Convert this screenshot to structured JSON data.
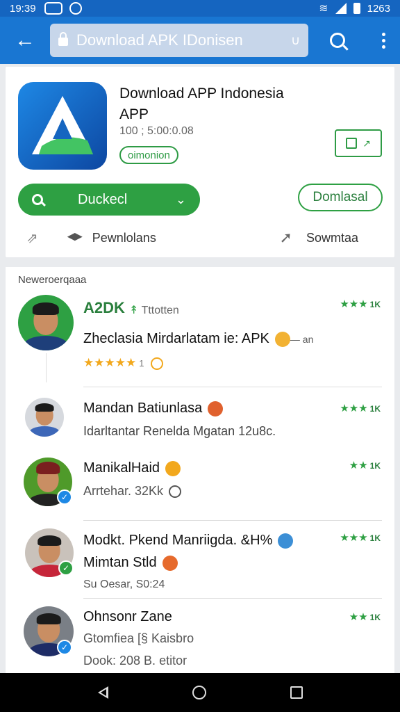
{
  "status_bar": {
    "time": "19:39",
    "battery": "1263"
  },
  "toolbar": {
    "search_text": "Download APK IDonisen"
  },
  "app": {
    "title": "Download APP Indonesia APP",
    "meta": "100 ; 5:00:0.08",
    "badge": "oimonion",
    "install_label": "Duckecl",
    "download_label": "Domlasal",
    "stat_left": "Pewnlolans",
    "stat_right": "Sowmtaa",
    "icon_colors": {
      "bg": "#1976d2",
      "accent": "#43c463"
    }
  },
  "reviews": {
    "heading": "Neweroerqaaa",
    "items": [
      {
        "name": "A2DK",
        "tag": "Tttotten",
        "sub": "Zheclasia Mirdarlatam ie: APK",
        "sub_suffix": "— an",
        "stars_text": "★★★★★",
        "stars_count": "1",
        "rating_stars": "★★★",
        "rating_count": "1K",
        "avatar_bg": "#2ea043",
        "shirt": "#1e3f7a"
      },
      {
        "name": "Mandan Batiunlasa",
        "sub": "Idarltantar Renelda Mgatan 12u8c.",
        "rating_stars": "★★★",
        "rating_count": "1K",
        "avatar_bg": "#d6d9de",
        "shirt": "#3d67b8"
      },
      {
        "name": "ManikalHaid",
        "sub": "Arrtehar. 32Kk",
        "rating_stars": "★★",
        "rating_count": "1K",
        "avatar_bg": "#4f9a2a",
        "shirt": "#222"
      },
      {
        "name": "Modkt. Pkend Manriigda.",
        "name_suffix": "&H%",
        "sub": "Mimtan Stld",
        "sub2": "Su Oesar, S0:24",
        "rating_stars": "★★★",
        "rating_count": "1K",
        "avatar_bg": "#c9c2bb",
        "shirt": "#c6263a"
      },
      {
        "name": "Ohnsonr Zane",
        "sub": "Gtomfiea [§ Kaisbro",
        "sub2": "Dook: 208 B. etitor",
        "rating_stars": "★★",
        "rating_count": "1K",
        "avatar_bg": "#7a7f86",
        "shirt": "#1e2c66"
      }
    ]
  }
}
